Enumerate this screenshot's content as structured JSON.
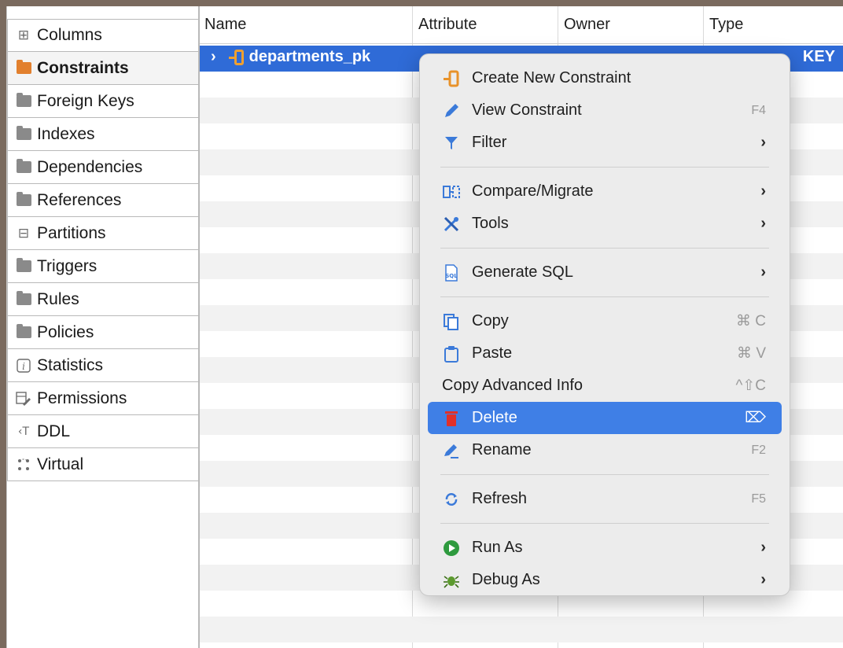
{
  "tabs": [
    {
      "label": "Columns",
      "icon": "columns-icon"
    },
    {
      "label": "Constraints",
      "icon": "folder-orange-icon",
      "active": true
    },
    {
      "label": "Foreign Keys",
      "icon": "folder-icon"
    },
    {
      "label": "Indexes",
      "icon": "folder-icon"
    },
    {
      "label": "Dependencies",
      "icon": "folder-icon"
    },
    {
      "label": "References",
      "icon": "folder-icon"
    },
    {
      "label": "Partitions",
      "icon": "partitions-icon"
    },
    {
      "label": "Triggers",
      "icon": "folder-icon"
    },
    {
      "label": "Rules",
      "icon": "folder-icon"
    },
    {
      "label": "Policies",
      "icon": "folder-icon"
    },
    {
      "label": "Statistics",
      "icon": "info-icon"
    },
    {
      "label": "Permissions",
      "icon": "permissions-icon"
    },
    {
      "label": "DDL",
      "icon": "ddl-icon"
    },
    {
      "label": "Virtual",
      "icon": "virtual-icon"
    }
  ],
  "table": {
    "columns": [
      "Name",
      "Attribute",
      "Owner",
      "Type"
    ],
    "selected_row": {
      "name": "departments_pk",
      "type_partial": "KEY"
    }
  },
  "menu": {
    "create_new_constraint": "Create New Constraint",
    "view_constraint": "View Constraint",
    "view_constraint_shortcut": "F4",
    "filter": "Filter",
    "compare_migrate": "Compare/Migrate",
    "tools": "Tools",
    "generate_sql": "Generate SQL",
    "copy": "Copy",
    "copy_shortcut": "⌘ C",
    "paste": "Paste",
    "paste_shortcut": "⌘ V",
    "copy_advanced_info": "Copy Advanced Info",
    "copy_advanced_info_shortcut": "^⇧C",
    "delete": "Delete",
    "delete_shortcut": "⌦",
    "rename": "Rename",
    "rename_shortcut": "F2",
    "refresh": "Refresh",
    "refresh_shortcut": "F5",
    "run_as": "Run As",
    "debug_as": "Debug As",
    "submenu_arrow": "›"
  },
  "colors": {
    "selection": "#2f6bd7",
    "menu_highlight": "#3f7fe6",
    "delete_icon": "#e0302a"
  }
}
